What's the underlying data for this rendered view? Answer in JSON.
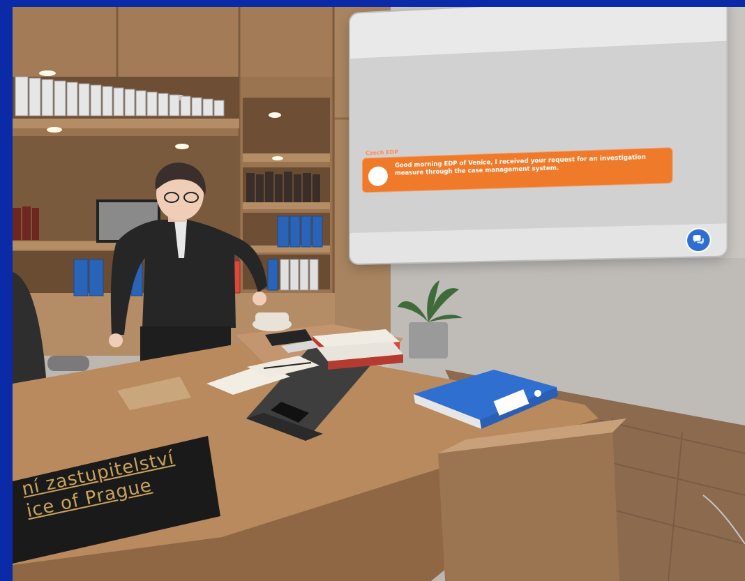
{
  "chat": {
    "speaker": "Czech EDP",
    "message": "Good morning EDP of Venice, I received your request for an investigation measure through the case management system.",
    "chat_button_icon": "chat-bubbles-icon"
  },
  "nameplate": {
    "line1": "ní zastupitelství",
    "line2": "ice of Prague"
  },
  "colors": {
    "frame": "#0a2aa8",
    "bubble": "#ef7a2a",
    "chat_button": "#2c6fd0"
  }
}
